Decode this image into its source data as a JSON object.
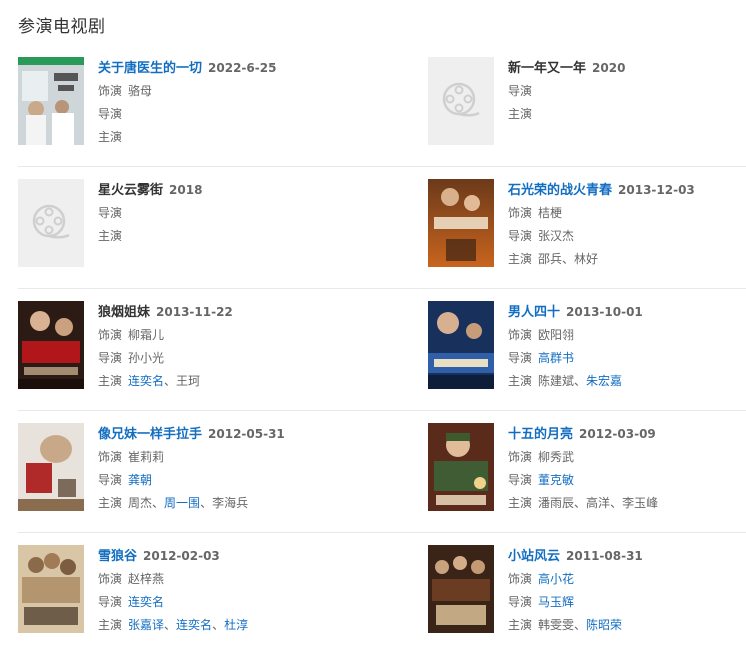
{
  "section": {
    "title": "参演电视剧"
  },
  "colors": {
    "link": "#136ec2",
    "text": "#333333",
    "muted": "#666666",
    "placeholder_bg": "#efefef"
  },
  "labels": {
    "role": "饰演",
    "director": "导演",
    "cast": "主演"
  },
  "works": [
    {
      "title": "关于唐医生的一切",
      "date": "2022-6-25",
      "title_link": true,
      "poster": "poster-doctor",
      "role": [
        {
          "t": "骆母",
          "link": false
        }
      ],
      "director": [],
      "cast": []
    },
    {
      "title": "新一年又一年",
      "date": "2020",
      "title_link": false,
      "poster": "film-reel-placeholder-icon",
      "role": null,
      "director": [],
      "cast": []
    },
    {
      "title": "星火云雾街",
      "date": "2018",
      "title_link": false,
      "poster": "film-reel-placeholder-icon",
      "role": null,
      "director": [],
      "cast": []
    },
    {
      "title": "石光荣的战火青春",
      "date": "2013-12-03",
      "title_link": true,
      "poster": "poster-war",
      "role": [
        {
          "t": "桔梗",
          "link": false
        }
      ],
      "director": [
        {
          "t": "张汉杰",
          "link": false
        }
      ],
      "cast": [
        {
          "t": "邵兵",
          "link": false
        },
        {
          "t": "林好",
          "link": false
        }
      ]
    },
    {
      "title": "狼烟姐妹",
      "date": "2013-11-22",
      "title_link": false,
      "poster": "poster-sisters",
      "role": [
        {
          "t": "柳霜儿",
          "link": false
        }
      ],
      "director": [
        {
          "t": "孙小光",
          "link": false
        }
      ],
      "cast": [
        {
          "t": "连奕名",
          "link": true
        },
        {
          "t": "王珂",
          "link": false
        }
      ]
    },
    {
      "title": "男人四十",
      "date": "2013-10-01",
      "title_link": true,
      "poster": "poster-men40",
      "role": [
        {
          "t": "欧阳翎",
          "link": false
        }
      ],
      "director": [
        {
          "t": "高群书",
          "link": true
        }
      ],
      "cast": [
        {
          "t": "陈建斌",
          "link": false
        },
        {
          "t": "朱宏嘉",
          "link": true
        }
      ]
    },
    {
      "title": "像兄妹一样手拉手",
      "date": "2012-05-31",
      "title_link": true,
      "poster": "poster-hands",
      "role": [
        {
          "t": "崔莉莉",
          "link": false
        }
      ],
      "director": [
        {
          "t": "龚朝",
          "link": true
        }
      ],
      "cast": [
        {
          "t": "周杰",
          "link": false
        },
        {
          "t": "周一围",
          "link": true
        },
        {
          "t": "李海兵",
          "link": false
        }
      ]
    },
    {
      "title": "十五的月亮",
      "date": "2012-03-09",
      "title_link": true,
      "poster": "poster-moon",
      "role": [
        {
          "t": "柳秀武",
          "link": false
        }
      ],
      "director": [
        {
          "t": "董克敏",
          "link": true
        }
      ],
      "cast": [
        {
          "t": "潘雨辰",
          "link": false
        },
        {
          "t": "高洋",
          "link": false
        },
        {
          "t": "李玉峰",
          "link": false
        }
      ]
    },
    {
      "title": "雪狼谷",
      "date": "2012-02-03",
      "title_link": true,
      "poster": "poster-wolf",
      "role": [
        {
          "t": "赵梓燕",
          "link": false
        }
      ],
      "director": [
        {
          "t": "连奕名",
          "link": true
        }
      ],
      "cast": [
        {
          "t": "张嘉译",
          "link": true
        },
        {
          "t": "连奕名",
          "link": true
        },
        {
          "t": "杜淳",
          "link": true
        }
      ]
    },
    {
      "title": "小站风云",
      "date": "2011-08-31",
      "title_link": true,
      "poster": "poster-station",
      "role": [
        {
          "t": "高小花",
          "link": true
        }
      ],
      "director": [
        {
          "t": "马玉辉",
          "link": true
        }
      ],
      "cast": [
        {
          "t": "韩雯雯",
          "link": false
        },
        {
          "t": "陈昭荣",
          "link": true
        }
      ]
    }
  ]
}
